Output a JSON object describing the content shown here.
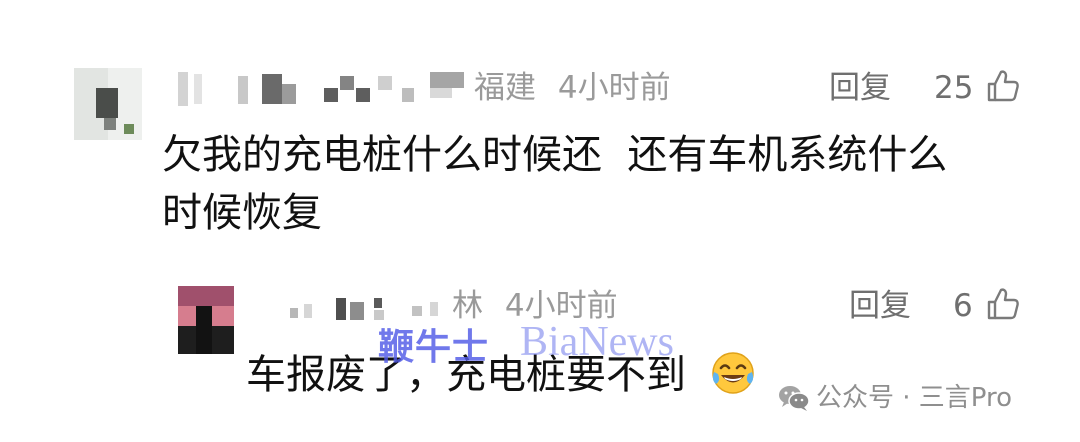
{
  "comment": {
    "location": "福建",
    "time": "4小时前",
    "reply_label": "回复",
    "like_count": "25",
    "text_line1": "欠我的充电桩什么时候还  还有车机系统什么",
    "text_line2": "时候恢复"
  },
  "reply": {
    "name_tail": "林",
    "time": "4小时前",
    "reply_label": "回复",
    "like_count": "6",
    "text": "车报废了，充电桩要不到"
  },
  "watermark": {
    "cn": "鞭牛士",
    "en": "BiaNews"
  },
  "source_mark": {
    "text": "公众号 · 三言Pro"
  },
  "icons": {
    "like": "thumbs-up-icon",
    "emoji": "tears-of-joy-emoji",
    "wechat": "wechat-icon"
  }
}
